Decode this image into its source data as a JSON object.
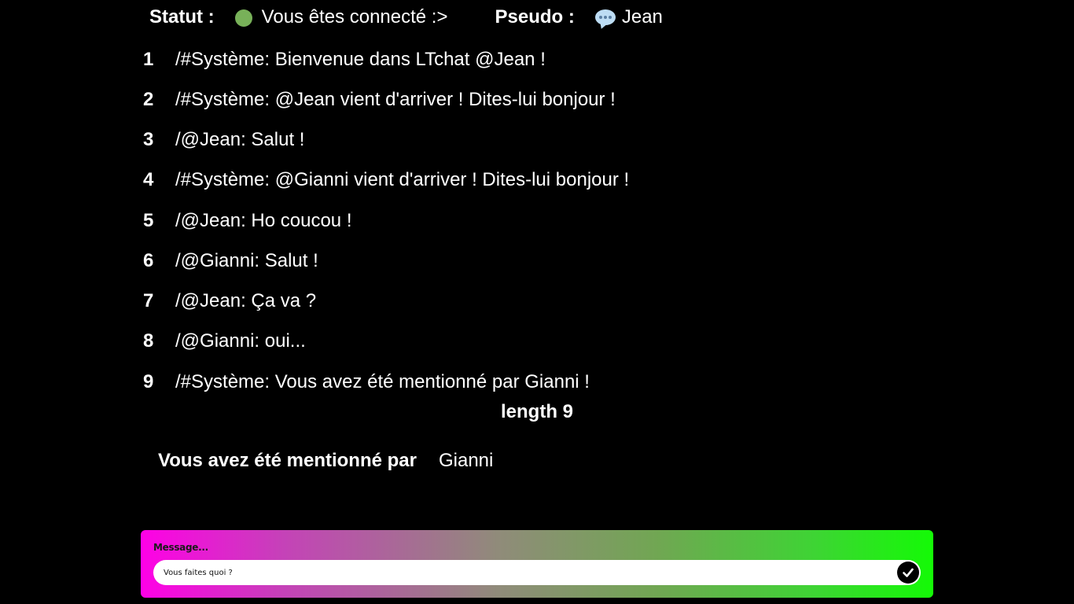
{
  "header": {
    "status_label": "Statut :",
    "status_text": "Vous êtes connecté :>",
    "status_color": "#78b159",
    "pseudo_label": "Pseudo :",
    "pseudo_value": "Jean",
    "pseudo_icon": "speech-bubble-icon"
  },
  "messages": [
    {
      "num": "1",
      "text": "/#Système: Bienvenue dans LTchat @Jean !"
    },
    {
      "num": "2",
      "text": "/#Système: @Jean vient d'arriver ! Dites-lui bonjour !"
    },
    {
      "num": "3",
      "text": "/@Jean: Salut !"
    },
    {
      "num": "4",
      "text": "/#Système: @Gianni vient d'arriver ! Dites-lui bonjour !"
    },
    {
      "num": "5",
      "text": "/@Jean: Ho coucou !"
    },
    {
      "num": "6",
      "text": "/@Gianni: Salut !"
    },
    {
      "num": "7",
      "text": "/@Jean: Ça va ?"
    },
    {
      "num": "8",
      "text": "/@Gianni: oui..."
    },
    {
      "num": "9",
      "text": "/#Système: Vous avez été mentionné par Gianni !"
    }
  ],
  "length_text": "length 9",
  "mention": {
    "label": "Vous avez été mentionné par",
    "user": "Gianni"
  },
  "composer": {
    "label": "Message...",
    "value": "Vous faites quoi ?",
    "send_icon": "check-icon",
    "gradient_start": "#ff00e6",
    "gradient_end": "#14fa06"
  }
}
